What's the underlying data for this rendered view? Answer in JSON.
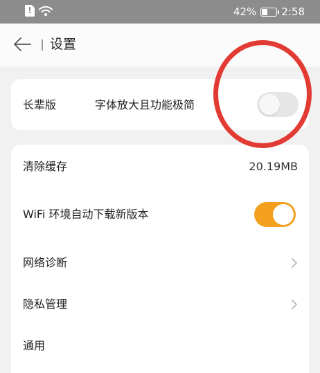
{
  "status_bar": {
    "left_icons": [
      "sim-alert-icon",
      "wifi-icon"
    ],
    "battery_percent": "42%",
    "battery_icon": "battery-icon",
    "time": "2:58"
  },
  "header": {
    "back_icon": "arrow-left-icon",
    "title": "设置"
  },
  "elder_mode": {
    "label": "长辈版",
    "description": "字体放大且功能极简",
    "enabled": false
  },
  "settings": {
    "clear_cache": {
      "label": "清除缓存",
      "value": "20.19MB"
    },
    "wifi_auto_download": {
      "label": "WiFi 环境自动下载新版本",
      "enabled": true
    },
    "network_diagnosis": {
      "label": "网络诊断",
      "icon": "chevron-right-icon"
    },
    "privacy_management": {
      "label": "隐私管理",
      "icon": "chevron-right-icon"
    },
    "general": {
      "label": "通用"
    }
  },
  "colors": {
    "status_bar_bg": "#8c8c8c",
    "page_bg": "#f1f1f1",
    "toggle_on": "#f2a01e",
    "toggle_off": "#e6e6e6",
    "annotation_circle": "#e23b33"
  }
}
